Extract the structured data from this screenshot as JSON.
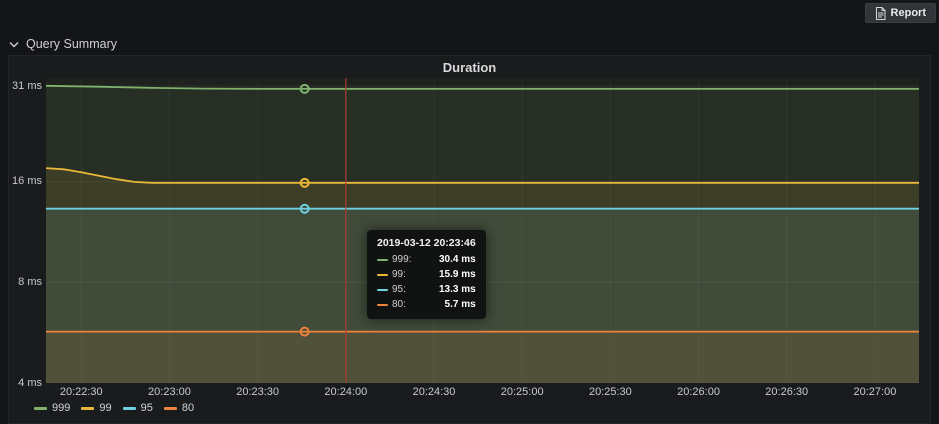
{
  "page": {
    "bg": "#141517"
  },
  "topbar": {
    "report_button": {
      "label": "Report",
      "icon": "report-document-icon"
    }
  },
  "section": {
    "title": "Query Summary",
    "icon": "chevron-down-icon"
  },
  "panel": {
    "title": "Duration"
  },
  "chart_data": {
    "type": "area",
    "title": "Duration",
    "legend_position": "bottom",
    "grid": true,
    "fill_opacity": 0.1,
    "y_axis": {
      "scale": "log2",
      "unit": "ms",
      "range": [
        4,
        31
      ],
      "ticks": [
        {
          "label": "31 ms",
          "value": 31
        },
        {
          "label": "16 ms",
          "value": 16
        },
        {
          "label": "8 ms",
          "value": 8
        },
        {
          "label": "4 ms",
          "value": 4
        }
      ]
    },
    "x_axis": {
      "start_time": "20:22:18",
      "end_time": "20:27:15",
      "duration_s": 297,
      "ticks": [
        {
          "label": "20:22:30",
          "s": 12
        },
        {
          "label": "20:23:00",
          "s": 42
        },
        {
          "label": "20:23:30",
          "s": 72
        },
        {
          "label": "20:24:00",
          "s": 102
        },
        {
          "label": "20:24:30",
          "s": 132
        },
        {
          "label": "20:25:00",
          "s": 162
        },
        {
          "label": "20:25:30",
          "s": 192
        },
        {
          "label": "20:26:00",
          "s": 222
        },
        {
          "label": "20:26:30",
          "s": 252
        },
        {
          "label": "20:27:00",
          "s": 282
        }
      ]
    },
    "series": [
      {
        "name": "999",
        "color": "#7EB26D",
        "hover_value": 30.4,
        "points": [
          [
            0,
            31.05
          ],
          [
            18,
            30.85
          ],
          [
            36,
            30.6
          ],
          [
            54,
            30.45
          ],
          [
            72,
            30.4
          ],
          [
            297,
            30.4
          ]
        ]
      },
      {
        "name": "99",
        "color": "#EAB839",
        "hover_value": 15.9,
        "points": [
          [
            0,
            17.6
          ],
          [
            6,
            17.45
          ],
          [
            12,
            17.1
          ],
          [
            18,
            16.7
          ],
          [
            24,
            16.3
          ],
          [
            30,
            16.0
          ],
          [
            36,
            15.9
          ],
          [
            297,
            15.9
          ]
        ]
      },
      {
        "name": "95",
        "color": "#6ED0E0",
        "hover_value": 13.3,
        "points": [
          [
            0,
            13.3
          ],
          [
            297,
            13.3
          ]
        ]
      },
      {
        "name": "80",
        "color": "#EF843C",
        "hover_value": 5.7,
        "points": [
          [
            0,
            5.7
          ],
          [
            297,
            5.7
          ]
        ]
      }
    ],
    "crosshair": {
      "time_s": 102,
      "color": "#aa3b30"
    },
    "hover": {
      "time_s": 88
    }
  },
  "tooltip": {
    "timestamp": "2019-03-12 20:23:46",
    "rows": [
      {
        "name": "999:",
        "value": "30.4 ms",
        "color": "#7EB26D"
      },
      {
        "name": "99:",
        "value": "15.9 ms",
        "color": "#EAB839"
      },
      {
        "name": "95:",
        "value": "13.3 ms",
        "color": "#6ED0E0"
      },
      {
        "name": "80:",
        "value": "5.7 ms",
        "color": "#EF843C"
      }
    ]
  }
}
